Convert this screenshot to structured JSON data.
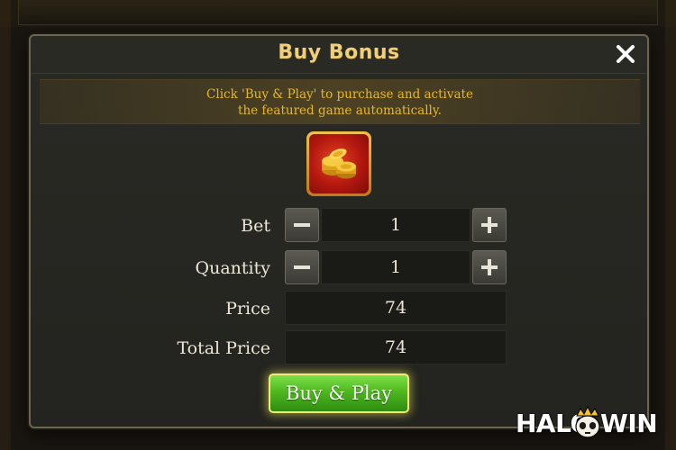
{
  "dialog": {
    "title": "Buy Bonus",
    "notice_line1": "Click 'Buy & Play' to purchase and activate",
    "notice_line2": "the featured game automatically."
  },
  "rows": {
    "bet": {
      "label": "Bet",
      "value": "1"
    },
    "quantity": {
      "label": "Quantity",
      "value": "1"
    },
    "price": {
      "label": "Price",
      "value": "74"
    },
    "total_price": {
      "label": "Total Price",
      "value": "74"
    }
  },
  "buy_button": {
    "label": "Buy & Play"
  },
  "logo": {
    "left": "HALO",
    "right": "WIN"
  },
  "icons": {
    "close": "close-icon",
    "minus": "minus-icon",
    "plus": "plus-icon",
    "feature": "gold-coins-icon"
  },
  "colors": {
    "title": "#f0cf7a",
    "notice_text": "#e8b824",
    "button_green": "#4fb81f",
    "button_glow": "#f5e87a"
  }
}
